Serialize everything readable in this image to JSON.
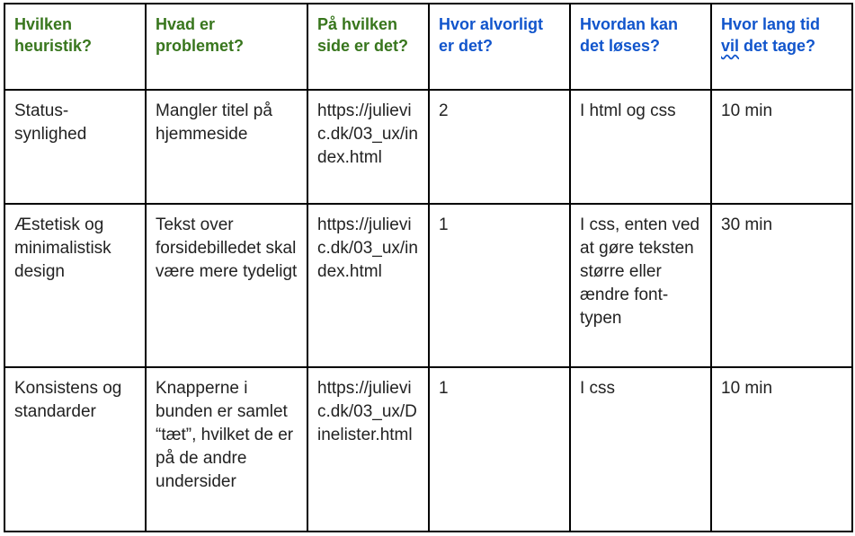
{
  "headers": [
    {
      "text": "Hvilken heuristik?",
      "color": "#38761d"
    },
    {
      "text": "Hvad er problemet?",
      "color": "#38761d"
    },
    {
      "text": "På hvilken side er det?",
      "color": "#38761d"
    },
    {
      "text": "Hvor alvorligt er det?",
      "color": "#1155cc"
    },
    {
      "text": "Hvordan kan det løses?",
      "color": "#1155cc"
    },
    {
      "text_before": "Hvor lang tid ",
      "text_spell": "vil",
      "text_after": " det tage?",
      "color": "#1155cc"
    }
  ],
  "rows": [
    {
      "heuristik": "Status-synlighed",
      "problem": "Mangler titel på hjemmeside",
      "side": "https://julievic.dk/03_ux/index.html",
      "alvor": "2",
      "loesning": "I html og css",
      "tid": "10 min"
    },
    {
      "heuristik": "Æstetisk og minimalistisk design",
      "problem": "Tekst over forsidebilledet skal være mere tydeligt",
      "side": "https://julievic.dk/03_ux/index.html",
      "alvor": "1",
      "loesning": "I css, enten ved at gøre teksten større eller ændre font-typen",
      "tid": "30 min"
    },
    {
      "heuristik": "Konsistens og standarder",
      "problem": "Knapperne  i bunden er samlet “tæt”, hvilket de er på de andre undersider",
      "side": "https://julievic.dk/03_ux/Dinelister.html",
      "alvor": "1",
      "loesning": "I css",
      "tid": "10 min"
    }
  ]
}
